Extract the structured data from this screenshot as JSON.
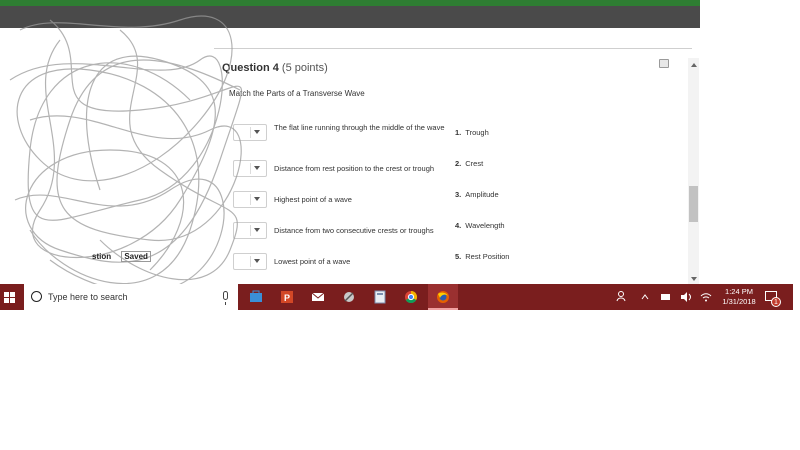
{
  "question": {
    "label": "Question 4",
    "points": "(5 points)",
    "instruction": "Match the Parts of a Transverse Wave"
  },
  "rows": [
    {
      "text": "The flat line running through the middle of the wave"
    },
    {
      "text": "Distance from rest position to the crest or trough"
    },
    {
      "text": "Highest point of a wave"
    },
    {
      "text": "Distance from two consecutive crests or troughs"
    },
    {
      "text": "Lowest point of a wave"
    }
  ],
  "options": [
    {
      "num": "1.",
      "label": "Trough"
    },
    {
      "num": "2.",
      "label": "Crest"
    },
    {
      "num": "3.",
      "label": "Amplitude"
    },
    {
      "num": "4.",
      "label": "Wavelength"
    },
    {
      "num": "5.",
      "label": "Rest Position"
    }
  ],
  "left_panel": {
    "question_fragment": "stion",
    "saved_label": "Saved"
  },
  "taskbar": {
    "search_placeholder": "Type here to search",
    "time": "1:24 PM",
    "date": "1/31/2018",
    "notification_count": "1",
    "apps": [
      "store-icon",
      "powerpoint-icon",
      "mail-icon",
      "snipping-tool-icon",
      "calculator-icon",
      "chrome-icon",
      "firefox-icon"
    ]
  },
  "colors": {
    "taskbar": "#7a1e1e",
    "brand_green": "#2e7d32",
    "nav_dark": "#4a4a4a"
  }
}
